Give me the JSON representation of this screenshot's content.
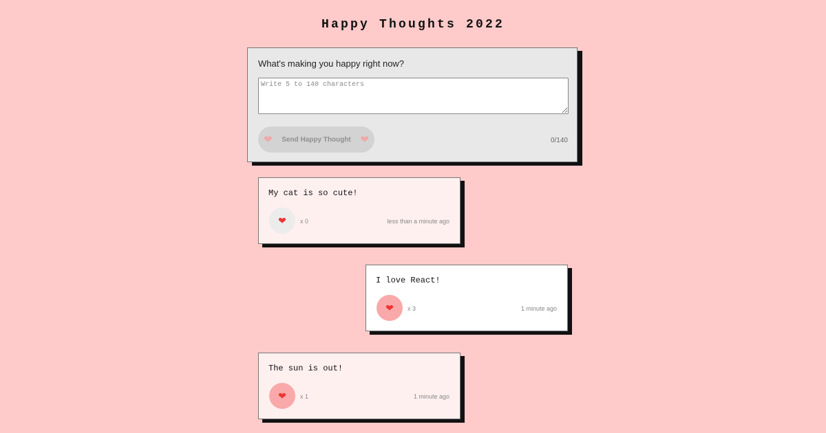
{
  "header": {
    "title": "Happy Thoughts 2022"
  },
  "form": {
    "question": "What's making you happy right now?",
    "input_value": "",
    "input_placeholder": "Write 5 to 140 characters",
    "send_label": "Send Happy Thought",
    "char_count": "0/140",
    "send_icon": "heart-icon"
  },
  "thoughts": [
    {
      "message": "My cat is so cute!",
      "likes_label": "x 0",
      "likes": 0,
      "time": "less than a minute ago",
      "liked": false,
      "icon": "heart-icon"
    },
    {
      "message": "I love React!",
      "likes_label": "x 3",
      "likes": 3,
      "time": "1 minute ago",
      "liked": true,
      "icon": "heart-icon"
    },
    {
      "message": "The sun is out!",
      "likes_label": "x 1",
      "likes": 1,
      "time": "1 minute ago",
      "liked": true,
      "icon": "heart-icon"
    }
  ],
  "colors": {
    "background": "#ffcaca",
    "form_background": "#e8e8e8",
    "card_pale": "#fff0f0",
    "card_white": "#ffffff",
    "liked_button": "#f9a9a9",
    "unliked_button": "#ececec",
    "shadow": "#111111"
  }
}
